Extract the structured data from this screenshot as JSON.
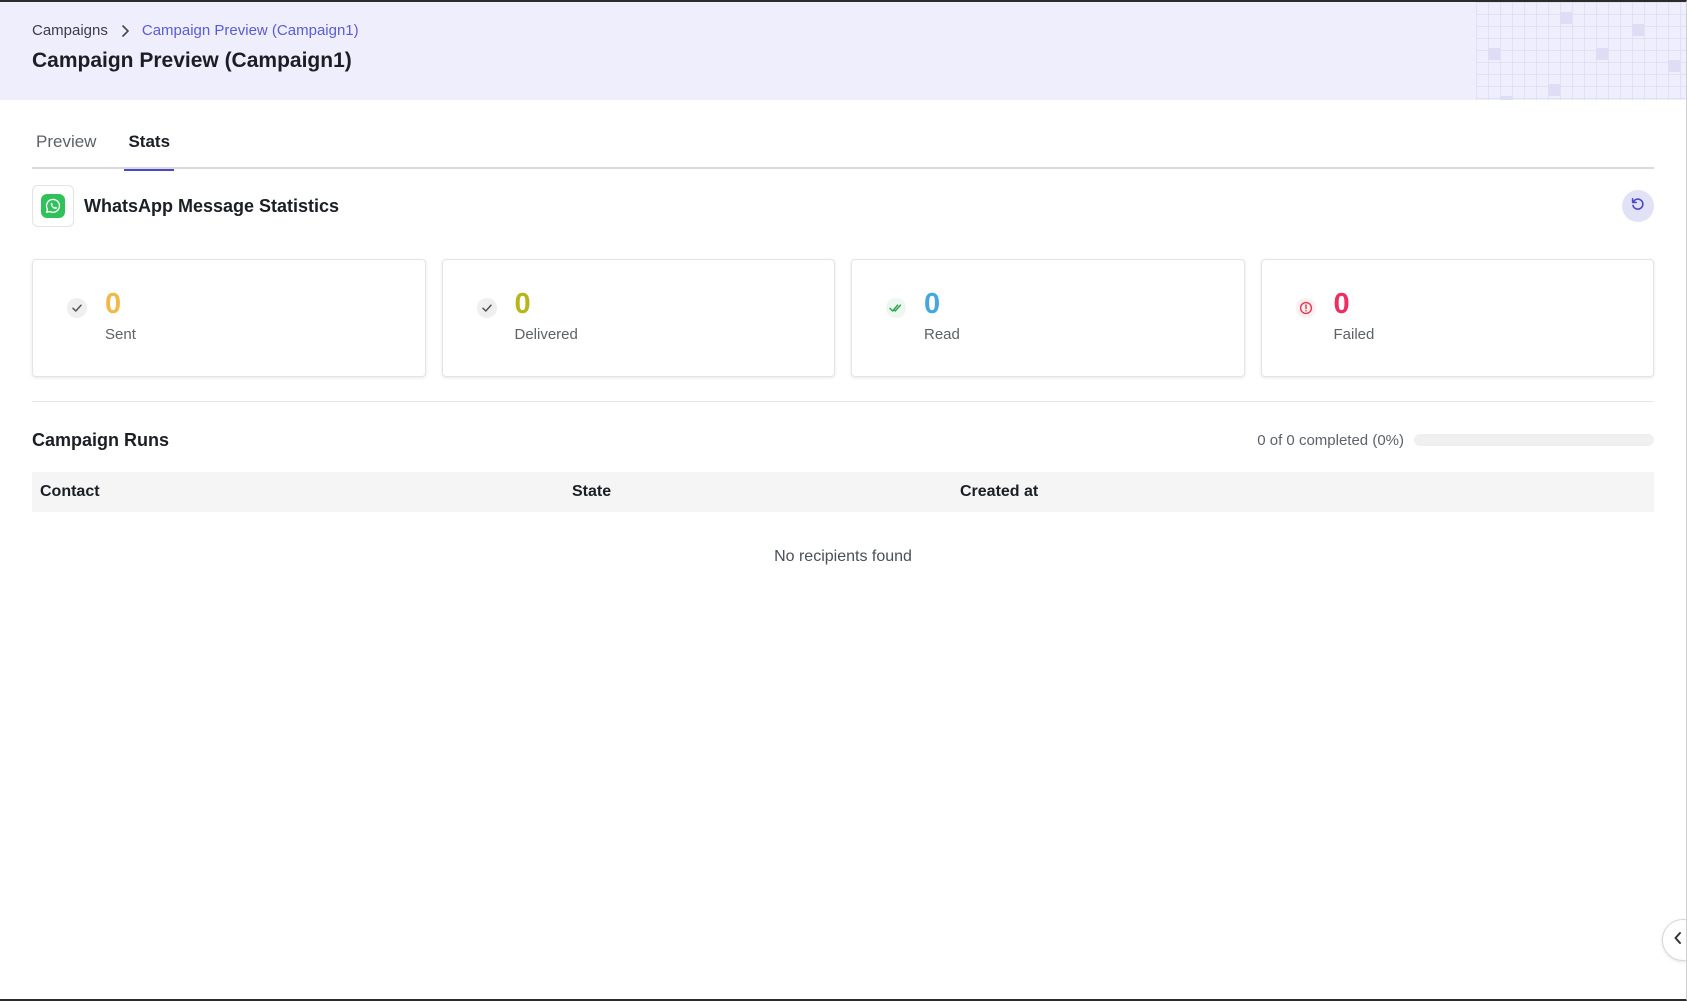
{
  "breadcrumb": {
    "root": "Campaigns",
    "current": "Campaign Preview (Campaign1)"
  },
  "page": {
    "title": "Campaign Preview (Campaign1)"
  },
  "tabs": [
    {
      "label": "Preview",
      "active": false
    },
    {
      "label": "Stats",
      "active": true
    }
  ],
  "stats": {
    "title": "WhatsApp Message Statistics",
    "icon": "whatsapp-icon",
    "refresh_icon": "refresh-icon",
    "cards": [
      {
        "label": "Sent",
        "value": "0",
        "color": "#f0b94a",
        "icon": "check-icon"
      },
      {
        "label": "Delivered",
        "value": "0",
        "color": "#b5b51d",
        "icon": "check-icon"
      },
      {
        "label": "Read",
        "value": "0",
        "color": "#45a6e0",
        "icon": "double-check-icon"
      },
      {
        "label": "Failed",
        "value": "0",
        "color": "#ee2d63",
        "icon": "alert-circle-icon"
      }
    ]
  },
  "runs": {
    "title": "Campaign Runs",
    "progress_text": "0 of 0 completed (0%)",
    "progress_percent": 0,
    "columns": [
      "Contact",
      "State",
      "Created at"
    ],
    "rows": [],
    "empty_text": "No recipients found"
  },
  "colors": {
    "accent": "#4b48c9",
    "header_bg": "#eeeefc",
    "breadcrumb_link": "#5b5bd6"
  }
}
